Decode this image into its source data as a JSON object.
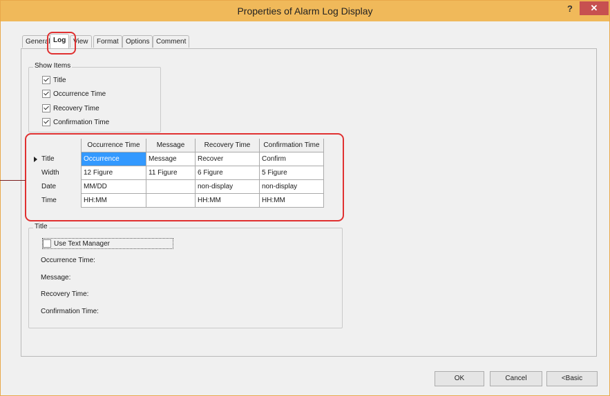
{
  "window": {
    "title": "Properties of Alarm Log Display",
    "help": "?",
    "close": "✕"
  },
  "tabs": [
    "General",
    "Log",
    "View",
    "Format",
    "Options",
    "Comment"
  ],
  "show_items": {
    "label": "Show Items",
    "items": [
      {
        "label": "Title",
        "checked": true
      },
      {
        "label": "Occurrence Time",
        "checked": true
      },
      {
        "label": "Recovery Time",
        "checked": true
      },
      {
        "label": "Confirmation Time",
        "checked": true
      }
    ]
  },
  "grid": {
    "columns": [
      "Occurrence Time",
      "Message",
      "Recovery Time",
      "Confirmation Time"
    ],
    "rows": [
      {
        "head": "Title",
        "cells": [
          "Occurrence",
          "Message",
          "Recover",
          "Confirm"
        ]
      },
      {
        "head": "Width",
        "cells": [
          "12 Figure",
          "11 Figure",
          "6 Figure",
          "5 Figure"
        ]
      },
      {
        "head": "Date",
        "cells": [
          "MM/DD",
          "",
          "non-display",
          "non-display"
        ]
      },
      {
        "head": "Time",
        "cells": [
          "HH:MM",
          "",
          "HH:MM",
          "HH:MM"
        ]
      }
    ]
  },
  "title_group": {
    "label": "Title",
    "use_text_manager": "Use Text Manager",
    "fields": [
      "Occurrence Time:",
      "Message:",
      "Recovery Time:",
      "Confirmation Time:"
    ]
  },
  "buttons": {
    "ok": "OK",
    "cancel": "Cancel",
    "basic": "<Basic"
  }
}
